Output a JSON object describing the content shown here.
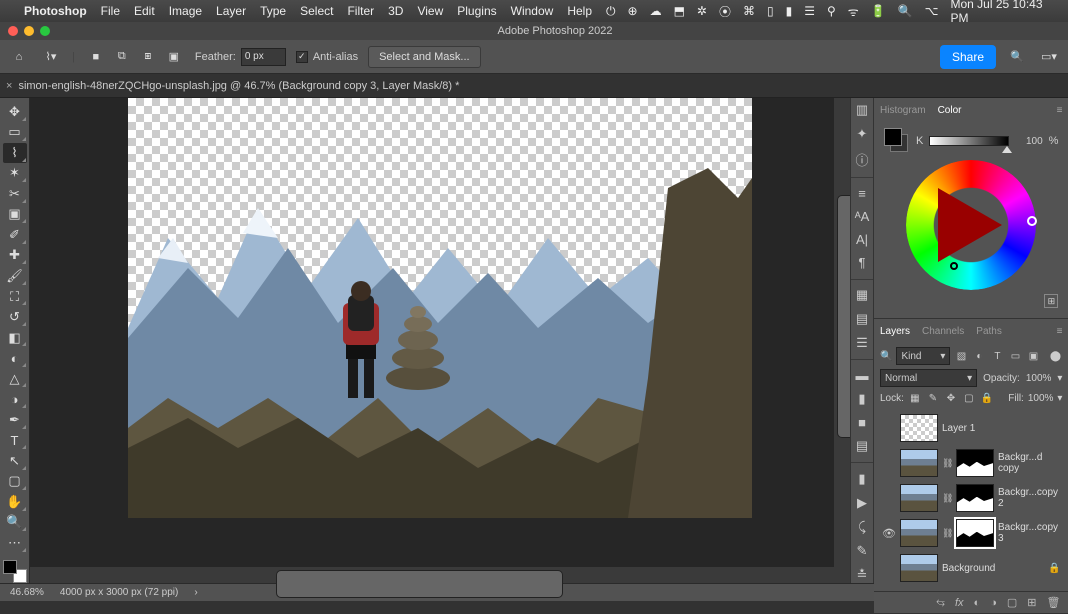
{
  "menubar": {
    "app": "Photoshop",
    "items": [
      "File",
      "Edit",
      "Image",
      "Layer",
      "Type",
      "Select",
      "Filter",
      "3D",
      "View",
      "Plugins",
      "Window",
      "Help"
    ],
    "clock": "Mon Jul 25  10:43 PM"
  },
  "titlebar": {
    "title": "Adobe Photoshop 2022"
  },
  "optionsbar": {
    "feather_label": "Feather:",
    "feather_value": "0 px",
    "antialias_label": "Anti-alias",
    "select_mask": "Select and Mask...",
    "share": "Share"
  },
  "doctab": {
    "label": "simon-english-48nerZQCHgo-unsplash.jpg @ 46.7% (Background copy 3, Layer Mask/8) *"
  },
  "tools": [
    {
      "name": "move-tool",
      "glyph": "✥"
    },
    {
      "name": "marquee-tool",
      "glyph": "▭"
    },
    {
      "name": "lasso-tool",
      "glyph": "⌇",
      "sel": true
    },
    {
      "name": "magic-wand-tool",
      "glyph": "✶"
    },
    {
      "name": "crop-tool",
      "glyph": "✂"
    },
    {
      "name": "frame-tool",
      "glyph": "▣"
    },
    {
      "name": "eyedropper-tool",
      "glyph": "✐"
    },
    {
      "name": "healing-brush-tool",
      "glyph": "✚"
    },
    {
      "name": "brush-tool",
      "glyph": "🖌"
    },
    {
      "name": "clone-stamp-tool",
      "glyph": "⛶"
    },
    {
      "name": "history-brush-tool",
      "glyph": "↺"
    },
    {
      "name": "eraser-tool",
      "glyph": "◧"
    },
    {
      "name": "gradient-tool",
      "glyph": "◐"
    },
    {
      "name": "blur-tool",
      "glyph": "△"
    },
    {
      "name": "dodge-tool",
      "glyph": "◑"
    },
    {
      "name": "pen-tool",
      "glyph": "✒"
    },
    {
      "name": "type-tool",
      "glyph": "T"
    },
    {
      "name": "path-select-tool",
      "glyph": "↖"
    },
    {
      "name": "shape-tool",
      "glyph": "▢"
    },
    {
      "name": "hand-tool",
      "glyph": "✋"
    },
    {
      "name": "zoom-tool",
      "glyph": "🔍"
    },
    {
      "name": "more-tools",
      "glyph": "⋯"
    }
  ],
  "collapsed_panels": [
    "▥",
    "✦",
    "ⓘ",
    "≡",
    "ᴬA",
    "A|",
    "¶",
    "▦",
    "▤",
    "☰",
    "▬",
    "▮",
    "■",
    "▤",
    "▮",
    "▶",
    "⤹",
    "✎",
    "≛"
  ],
  "color_panel": {
    "tabs": {
      "histogram": "Histogram",
      "color": "Color"
    },
    "k_label": "K",
    "k_value": "100",
    "k_unit": "%"
  },
  "layers_panel": {
    "tabs": {
      "layers": "Layers",
      "channels": "Channels",
      "paths": "Paths"
    },
    "kind_label": "Kind",
    "blend": "Normal",
    "opacity_label": "Opacity:",
    "opacity_value": "100%",
    "lock_label": "Lock:",
    "fill_label": "Fill:",
    "fill_value": "100%",
    "layers": [
      {
        "name": "Layer 1",
        "visible": false,
        "thumb": "checker",
        "mask": false
      },
      {
        "name": "Backgr...d copy",
        "visible": false,
        "thumb": "mtn",
        "mask": true,
        "mask_style": "normal"
      },
      {
        "name": "Backgr...copy 2",
        "visible": false,
        "thumb": "mtn",
        "mask": true,
        "mask_style": "normal"
      },
      {
        "name": "Backgr...copy 3",
        "visible": true,
        "thumb": "mtn",
        "mask": true,
        "mask_style": "inv",
        "mask_selected": true
      },
      {
        "name": "Background",
        "visible": false,
        "thumb": "mtn",
        "mask": false,
        "locked": true
      }
    ]
  },
  "statusbar": {
    "zoom": "46.68%",
    "dims": "4000 px x 3000 px (72 ppi)"
  },
  "colors": {
    "accent": "#0a84ff"
  }
}
